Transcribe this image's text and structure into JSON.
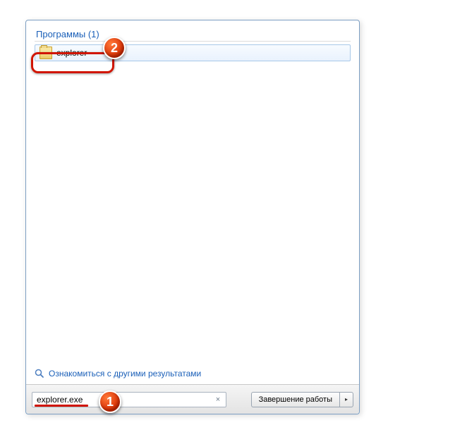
{
  "category": {
    "label": "Программы (1)"
  },
  "results": {
    "items": [
      {
        "label": "explorer",
        "icon": "folder-icon"
      }
    ]
  },
  "more_results": {
    "label": "Ознакомиться с другими результатами"
  },
  "search": {
    "value": "explorer.exe",
    "clear_glyph": "×"
  },
  "shutdown": {
    "label": "Завершение работы",
    "arrow_glyph": "▸"
  },
  "annotations": {
    "marker1": "1",
    "marker2": "2"
  }
}
